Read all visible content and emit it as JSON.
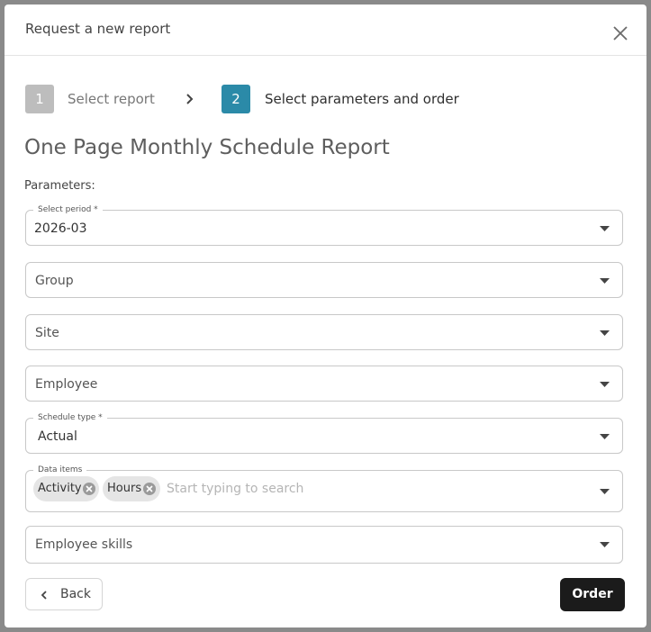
{
  "dialog": {
    "title": "Request a new report"
  },
  "stepper": {
    "steps": [
      {
        "number": "1",
        "label": "Select report",
        "state": "inactive"
      },
      {
        "number": "2",
        "label": "Select parameters and order",
        "state": "active"
      }
    ]
  },
  "report": {
    "title": "One Page Monthly Schedule Report",
    "parameters_label": "Parameters:"
  },
  "fields": {
    "period": {
      "legend": "Select period *",
      "value": "2026-03"
    },
    "group": {
      "placeholder": "Group"
    },
    "site": {
      "placeholder": "Site"
    },
    "employee": {
      "placeholder": "Employee"
    },
    "schedule_type": {
      "legend": "Schedule type *",
      "value": "Actual"
    },
    "data_items": {
      "legend": "Data items",
      "chips": [
        "Activity",
        "Hours"
      ],
      "placeholder": "Start typing to search"
    },
    "employee_skills": {
      "placeholder": "Employee skills"
    }
  },
  "footer": {
    "back_label": "Back",
    "order_label": "Order"
  },
  "colors": {
    "accent": "#2b8aa8",
    "step_inactive": "#bdbdbd",
    "primary_button": "#1b1b1b",
    "overlay": "#8a8a8a"
  },
  "icons": [
    "close-icon",
    "chevron-right-icon",
    "dropdown-arrow-icon",
    "chip-remove-icon",
    "chevron-left-icon"
  ]
}
